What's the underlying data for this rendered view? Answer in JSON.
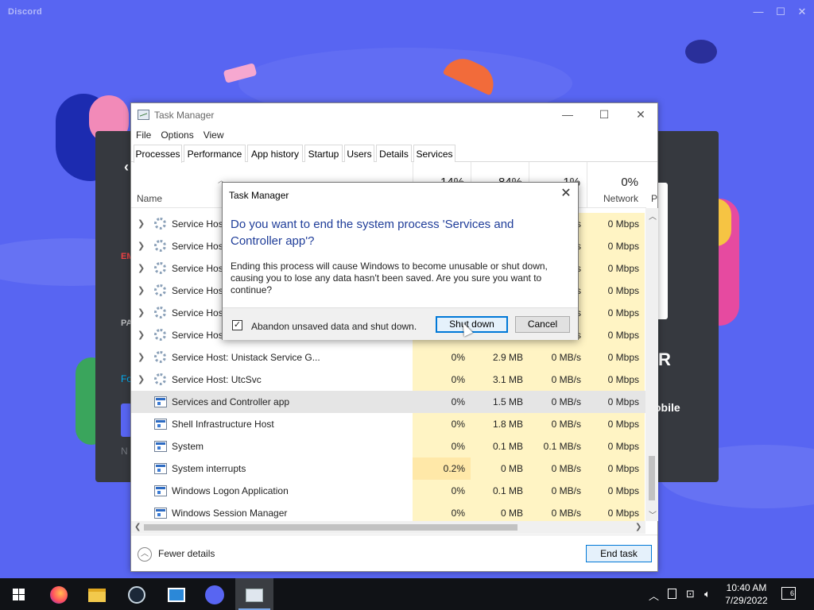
{
  "discord": {
    "title": "Discord",
    "bg_fragments": [
      "EM",
      "PA",
      "Fo",
      "N",
      "R",
      "obile"
    ]
  },
  "task_manager": {
    "title": "Task Manager",
    "menu": [
      "File",
      "Options",
      "View"
    ],
    "tabs": [
      "Processes",
      "Performance",
      "App history",
      "Startup",
      "Users",
      "Details",
      "Services"
    ],
    "active_tab": "Processes",
    "columns": {
      "name": "Name",
      "cpu": {
        "pct": "14%"
      },
      "memory": {
        "pct": "84%"
      },
      "disk": {
        "pct": "1%"
      },
      "network": {
        "pct": "0%",
        "label": "Network"
      },
      "power_partial": "P"
    },
    "rows": [
      {
        "name": "Service Host",
        "expand": true,
        "icon": "gear",
        "cpu": "",
        "mem": "",
        "disk": "s",
        "net": "0 Mbps"
      },
      {
        "name": "Service Host",
        "expand": true,
        "icon": "gear",
        "cpu": "",
        "mem": "",
        "disk": "s",
        "net": "0 Mbps"
      },
      {
        "name": "Service Host",
        "expand": true,
        "icon": "gear",
        "cpu": "",
        "mem": "",
        "disk": "s",
        "net": "0 Mbps"
      },
      {
        "name": "Service Host",
        "expand": true,
        "icon": "gear",
        "cpu": "",
        "mem": "",
        "disk": "s",
        "net": "0 Mbps"
      },
      {
        "name": "Service Host",
        "expand": true,
        "icon": "gear",
        "cpu": "",
        "mem": "",
        "disk": "s",
        "net": "0 Mbps"
      },
      {
        "name": "Service Host",
        "expand": true,
        "icon": "gear",
        "cpu": "",
        "mem": "",
        "disk": "s",
        "net": "0 Mbps"
      },
      {
        "name": "Service Host: Unistack Service G...",
        "expand": true,
        "icon": "gear",
        "cpu": "0%",
        "mem": "2.9 MB",
        "disk": "0 MB/s",
        "net": "0 Mbps"
      },
      {
        "name": "Service Host: UtcSvc",
        "expand": true,
        "icon": "gear",
        "cpu": "0%",
        "mem": "3.1 MB",
        "disk": "0 MB/s",
        "net": "0 Mbps"
      },
      {
        "name": "Services and Controller app",
        "expand": false,
        "icon": "win",
        "cpu": "0%",
        "mem": "1.5 MB",
        "disk": "0 MB/s",
        "net": "0 Mbps",
        "selected": true
      },
      {
        "name": "Shell Infrastructure Host",
        "expand": false,
        "icon": "win",
        "cpu": "0%",
        "mem": "1.8 MB",
        "disk": "0 MB/s",
        "net": "0 Mbps"
      },
      {
        "name": "System",
        "expand": false,
        "icon": "win",
        "cpu": "0%",
        "mem": "0.1 MB",
        "disk": "0.1 MB/s",
        "net": "0 Mbps"
      },
      {
        "name": "System interrupts",
        "expand": false,
        "icon": "win",
        "cpu": "0.2%",
        "mem": "0 MB",
        "disk": "0 MB/s",
        "net": "0 Mbps"
      },
      {
        "name": "Windows Logon Application",
        "expand": false,
        "icon": "win",
        "cpu": "0%",
        "mem": "0.1 MB",
        "disk": "0 MB/s",
        "net": "0 Mbps"
      },
      {
        "name": "Windows Session Manager",
        "expand": false,
        "icon": "win",
        "cpu": "0%",
        "mem": "0 MB",
        "disk": "0 MB/s",
        "net": "0 Mbps"
      }
    ],
    "footer": {
      "fewer_details": "Fewer details",
      "end_task": "End task"
    }
  },
  "dialog": {
    "title": "Task Manager",
    "heading": "Do you want to end the system process 'Services and Controller app'?",
    "body": "Ending this process will cause Windows to become unusable or shut down, causing you to lose any data hasn't been saved. Are you sure you want to continue?",
    "checkbox_label": "Abandon unsaved data and shut down.",
    "checkbox_checked": true,
    "shutdown_label": "Shut down",
    "cancel_label": "Cancel"
  },
  "taskbar": {
    "apps": [
      "firefox-icon",
      "file-explorer-icon",
      "steam-icon",
      "remote-desktop-icon",
      "discord-icon",
      "task-manager-icon"
    ],
    "active_app": "task-manager-icon",
    "time": "10:40 AM",
    "date": "7/29/2022",
    "notifications": "6"
  },
  "colors": {
    "discord_bg": "#5865f2",
    "accent": "#0078d7",
    "heat": "#fff4c4"
  }
}
